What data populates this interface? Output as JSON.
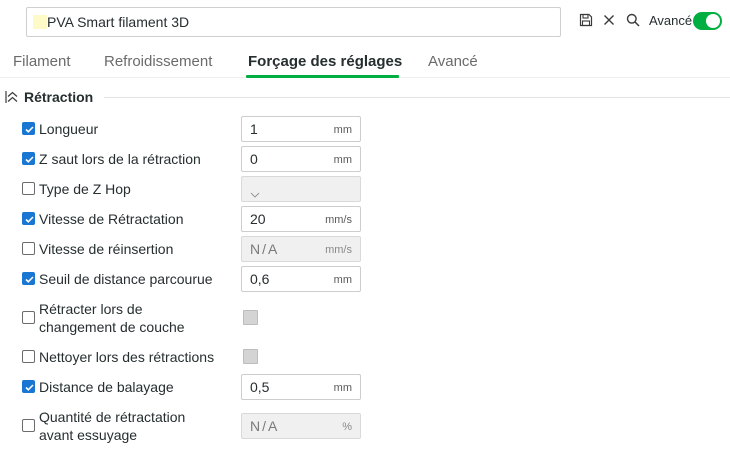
{
  "header": {
    "preset_name": "PVA Smart filament 3D",
    "advanced_label": "Avancé",
    "advanced_on": true,
    "icons": [
      "save-icon",
      "close-icon",
      "search-icon"
    ],
    "accent_color": "#00ae42"
  },
  "tabs": [
    {
      "label": "Filament",
      "active": false
    },
    {
      "label": "Refroidissement",
      "active": false
    },
    {
      "label": "Forçage des réglages",
      "active": true
    },
    {
      "label": "Avancé",
      "active": false
    }
  ],
  "section": {
    "title": "Rétraction",
    "icon": "collapse-icon"
  },
  "settings": [
    {
      "label": "Longueur",
      "checked": true,
      "type": "number",
      "value": "1",
      "unit": "mm"
    },
    {
      "label": "Z saut lors de la rétraction",
      "checked": true,
      "type": "number",
      "value": "0",
      "unit": "mm"
    },
    {
      "label": "Type de Z Hop",
      "checked": false,
      "type": "select",
      "value": ""
    },
    {
      "label": "Vitesse de Rétractation",
      "checked": true,
      "type": "number",
      "value": "20",
      "unit": "mm/s"
    },
    {
      "label": "Vitesse de réinsertion",
      "checked": false,
      "type": "disabled",
      "value": "N/A",
      "unit": "mm/s"
    },
    {
      "label": "Seuil de distance parcourue",
      "checked": true,
      "type": "number",
      "value": "0,6",
      "unit": "mm"
    },
    {
      "label": "Rétracter lors de changement de couche",
      "label_line1": "Rétracter lors de",
      "label_line2": "changement de couche",
      "checked": false,
      "type": "checkbox"
    },
    {
      "label": "Nettoyer lors des rétractions",
      "checked": false,
      "type": "checkbox"
    },
    {
      "label": "Distance de balayage",
      "checked": true,
      "type": "number",
      "value": "0,5",
      "unit": "mm"
    },
    {
      "label": "Quantité de rétractation avant essuyage",
      "label_line1": "Quantité de rétractation",
      "label_line2": "avant essuyage",
      "checked": false,
      "type": "disabled",
      "value": "N/A",
      "unit": "%"
    }
  ]
}
